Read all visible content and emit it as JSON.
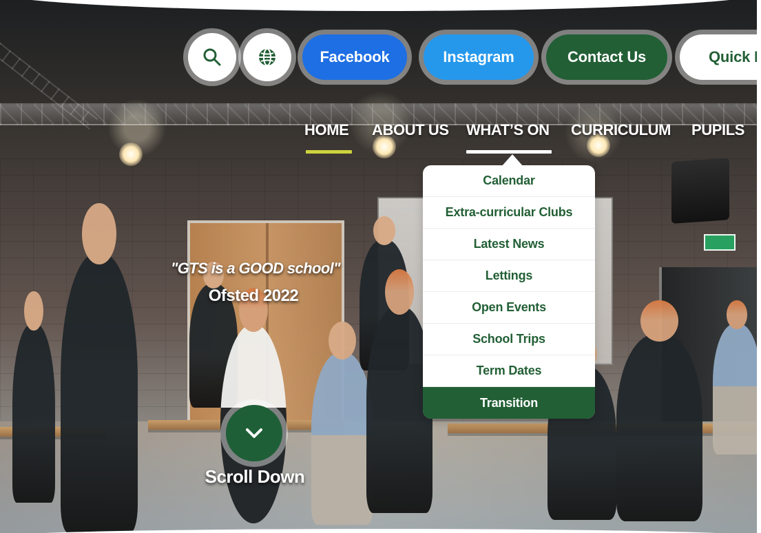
{
  "header": {
    "search_icon": "search-icon",
    "language_icon": "globe-icon",
    "social_links": [
      {
        "label": "Facebook"
      },
      {
        "label": "Instagram"
      }
    ],
    "contact_label": "Contact Us",
    "quick_links_label": "Quick Li"
  },
  "nav": {
    "items": [
      {
        "label": "HOME"
      },
      {
        "label": "ABOUT US"
      },
      {
        "label": "WHAT’S ON"
      },
      {
        "label": "CURRICULUM"
      },
      {
        "label": "PUPILS"
      }
    ]
  },
  "dropdown": {
    "items": [
      {
        "label": "Calendar"
      },
      {
        "label": "Extra-curricular Clubs"
      },
      {
        "label": "Latest News"
      },
      {
        "label": "Lettings"
      },
      {
        "label": "Open Events"
      },
      {
        "label": "School Trips"
      },
      {
        "label": "Term Dates"
      },
      {
        "label": "Transition"
      }
    ]
  },
  "hero": {
    "quote": "\"GTS is a GOOD school\"",
    "source": "Ofsted 2022",
    "scroll_label": "Scroll Down",
    "scroll_icon": "chevron-down-icon"
  },
  "colors": {
    "primary_green": "#225f35",
    "facebook_blue": "#1e6fe3",
    "instagram_blue": "#2598ec",
    "home_underline": "#cfd33c"
  }
}
